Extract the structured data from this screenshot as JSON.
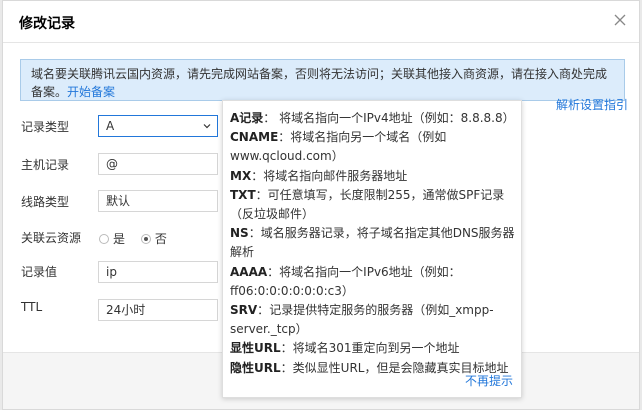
{
  "dialog": {
    "title": "修改记录"
  },
  "notice": {
    "text": "域名要关联腾讯云国内资源，请先完成网站备案，否则将无法访问；关联其他接入商资源，请在接入商处完成备案。",
    "link": "开始备案"
  },
  "resolve_help": "解析设置指引",
  "form": {
    "record_type": {
      "label": "记录类型",
      "value": "A"
    },
    "host": {
      "label": "主机记录",
      "value": "@"
    },
    "line": {
      "label": "线路类型",
      "value": "默认"
    },
    "cloud": {
      "label": "关联云资源",
      "options": [
        "是",
        "否"
      ],
      "selected": "否"
    },
    "record_value": {
      "label": "记录值",
      "value": "ip"
    },
    "ttl": {
      "label": "TTL",
      "value": "24小时"
    }
  },
  "tooltip": {
    "entries": [
      {
        "key": "A记录",
        "sep": "： ",
        "desc": "将域名指向一个IPv4地址（例如：8.8.8.8）"
      },
      {
        "key": "CNAME",
        "sep": "：",
        "desc": "将域名指向另一个域名（例如www.qcloud.com）"
      },
      {
        "key": "MX",
        "sep": "：",
        "desc": "将域名指向邮件服务器地址"
      },
      {
        "key": "TXT",
        "sep": "：",
        "desc": "可任意填写，长度限制255，通常做SPF记录（反垃圾邮件）"
      },
      {
        "key": "NS",
        "sep": "：",
        "desc": "域名服务器记录，将子域名指定其他DNS服务器解析"
      },
      {
        "key": "AAAA",
        "sep": "：",
        "desc": "将域名指向一个IPv6地址（例如：ff06:0:0:0:0:0:0:c3）"
      },
      {
        "key": "SRV",
        "sep": "：",
        "desc": "记录提供特定服务的服务器（例如_xmpp-server._tcp）"
      },
      {
        "key": "显性URL",
        "sep": "：",
        "desc": "将域名301重定向到另一个地址"
      },
      {
        "key": "隐性URL",
        "sep": "：",
        "desc": "类似显性URL，但是会隐藏真实目标地址"
      }
    ],
    "dismiss": "不再提示"
  }
}
